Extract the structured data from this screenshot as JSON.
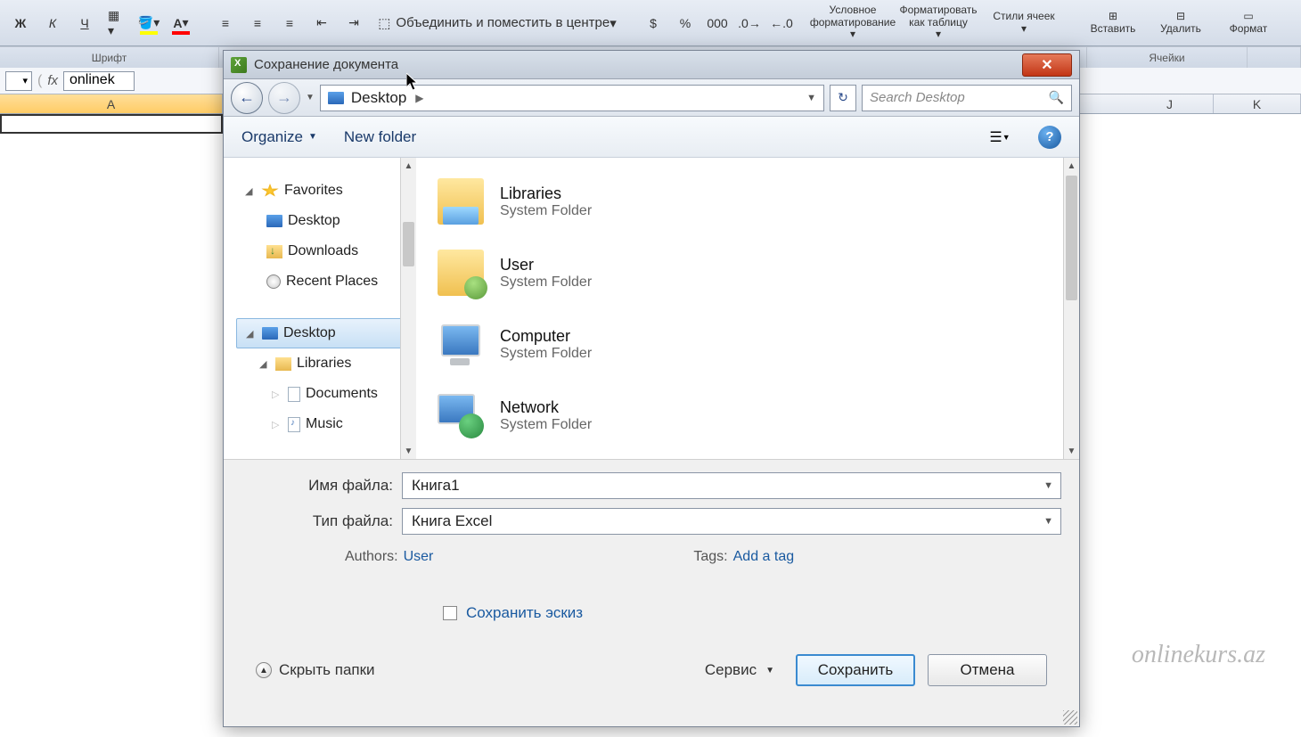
{
  "ribbon": {
    "bold": "Ж",
    "italic": "К",
    "underline": "Ч",
    "merge_center": "Объединить и поместить в центре",
    "currency": "$",
    "percent": "%",
    "thousands": "000",
    "conditional_format": "Условное форматирование",
    "format_table": "Форматировать как таблицу",
    "cell_styles": "Стили ячеек",
    "insert": "Вставить",
    "delete": "Удалить",
    "format": "Формат",
    "group_font": "Шрифт",
    "group_cells": "Ячейки"
  },
  "formula_bar": {
    "fx": "fx",
    "value": "onlinek"
  },
  "columns": [
    "A",
    "J",
    "K"
  ],
  "dialog": {
    "title": "Сохранение документа",
    "nav_location": "Desktop",
    "search_placeholder": "Search Desktop",
    "toolbar": {
      "organize": "Organize",
      "new_folder": "New folder"
    },
    "tree": {
      "favorites": "Favorites",
      "desktop": "Desktop",
      "downloads": "Downloads",
      "recent_places": "Recent Places",
      "desktop2": "Desktop",
      "libraries": "Libraries",
      "documents": "Documents",
      "music": "Music"
    },
    "files": [
      {
        "title": "Libraries",
        "subtitle": "System Folder"
      },
      {
        "title": "User",
        "subtitle": "System Folder"
      },
      {
        "title": "Computer",
        "subtitle": "System Folder"
      },
      {
        "title": "Network",
        "subtitle": "System Folder"
      }
    ],
    "filename_label": "Имя файла:",
    "filename_value": "Книга1",
    "filetype_label": "Тип файла:",
    "filetype_value": "Книга Excel",
    "authors_label": "Authors:",
    "authors_value": "User",
    "tags_label": "Tags:",
    "tags_value": "Add a tag",
    "save_thumbnail": "Сохранить эскиз",
    "hide_folders": "Скрыть папки",
    "tools": "Сервис",
    "save": "Сохранить",
    "cancel": "Отмена"
  },
  "watermark": "onlinekurs.az"
}
